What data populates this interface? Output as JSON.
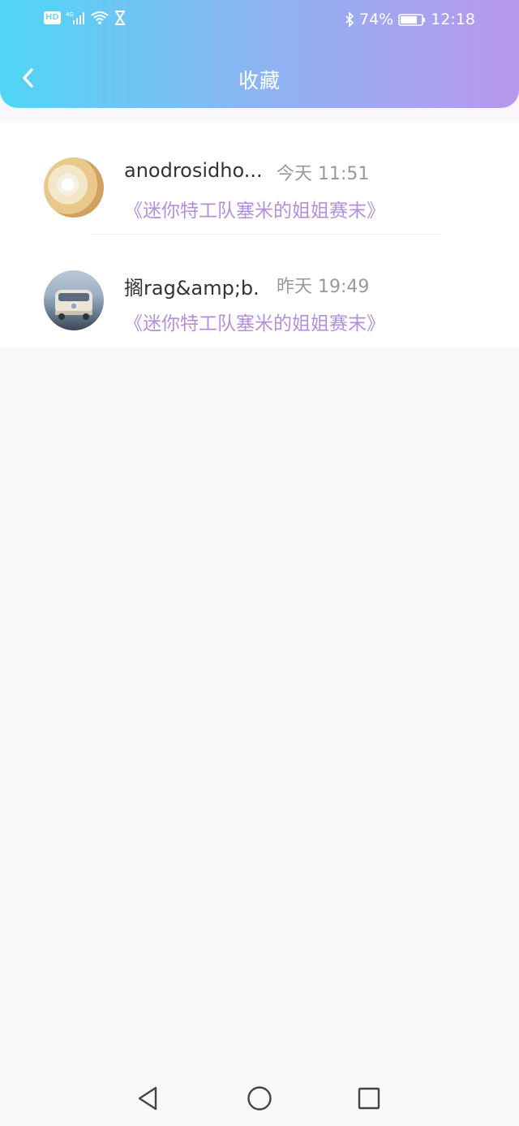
{
  "status_bar": {
    "hd": "HD",
    "network": "4G",
    "battery_pct": "74%",
    "time": "12:18"
  },
  "header": {
    "title": "收藏"
  },
  "favorites": [
    {
      "name": "anodrosidho...",
      "time": "今天 11:51",
      "book": "《迷你特工队塞米的姐姐赛末》"
    },
    {
      "name": "搁rag&amp;b...",
      "time": "昨天 19:49",
      "book": "《迷你特工队塞米的姐姐赛末》"
    }
  ],
  "colors": {
    "header_gradient_start": "#4fd6f6",
    "header_gradient_end": "#b897ee",
    "accent": "#b58fde"
  }
}
